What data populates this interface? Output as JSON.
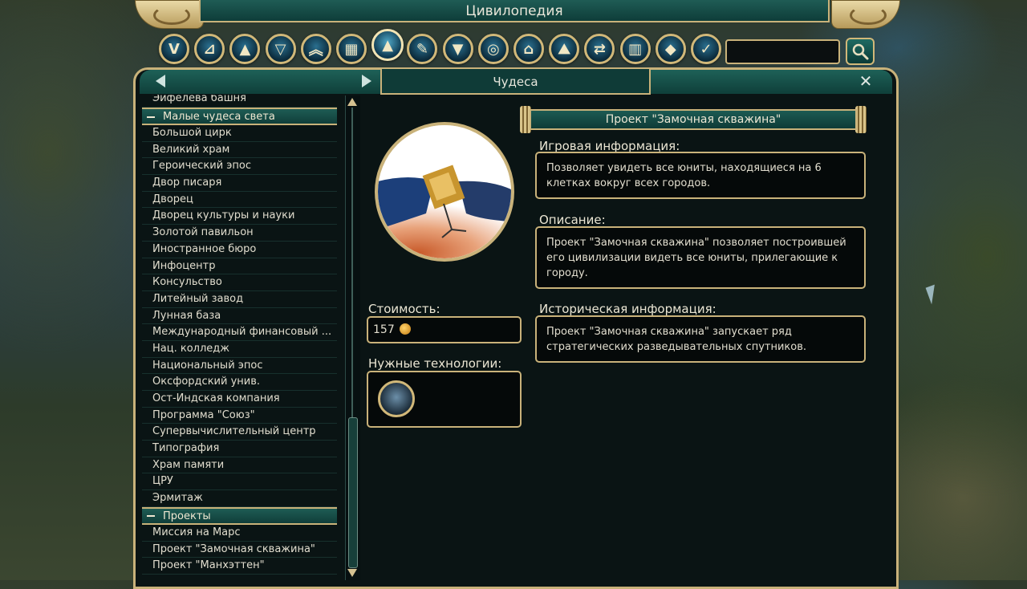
{
  "window": {
    "title": "Цивилопедия"
  },
  "categories": [
    {
      "icon": "v-icon",
      "glyph": "V"
    },
    {
      "icon": "compass-tools-icon",
      "glyph": "⊿"
    },
    {
      "icon": "tent-icon",
      "glyph": "▲"
    },
    {
      "icon": "triangle-emblem-icon",
      "glyph": "▽"
    },
    {
      "icon": "chevrons-icon",
      "glyph": "︽"
    },
    {
      "icon": "building-icon",
      "glyph": "▦"
    },
    {
      "icon": "pyramid-icon",
      "glyph": "▲",
      "active": true
    },
    {
      "icon": "scroll-icon",
      "glyph": "✎"
    },
    {
      "icon": "emblem-icon",
      "glyph": "▼"
    },
    {
      "icon": "globe-wreath-icon",
      "glyph": "◎"
    },
    {
      "icon": "capitol-icon",
      "glyph": "⌂"
    },
    {
      "icon": "ruins-icon",
      "glyph": "⛰"
    },
    {
      "icon": "handshake-icon",
      "glyph": "⇄"
    },
    {
      "icon": "city-icon",
      "glyph": "▥"
    },
    {
      "icon": "drop-icon",
      "glyph": "◆"
    },
    {
      "icon": "map-icon",
      "glyph": "✓"
    }
  ],
  "search": {
    "value": ""
  },
  "nav": {
    "section_title": "Чудеса",
    "close_glyph": "✕"
  },
  "list": {
    "top_item": "Эйфелева башня",
    "small_wonders_header": "Малые чудеса света",
    "small_wonders": [
      "Большой цирк",
      "Великий храм",
      "Героический эпос",
      "Двор писаря",
      "Дворец",
      "Дворец культуры и науки",
      "Золотой павильон",
      "Иностранное бюро",
      "Инфоцентр",
      "Консульство",
      "Литейный завод",
      "Лунная база",
      "Международный финансовый ...",
      "Нац. колледж",
      "Национальный эпос",
      "Оксфордский унив.",
      "Ост-Индская компания",
      "Программа \"Союз\"",
      "Супервычислительный центр",
      "Типография",
      "Храм памяти",
      "ЦРУ",
      "Эрмитаж"
    ],
    "projects_header": "Проекты",
    "projects": [
      "Миссия на Марс",
      "Проект \"Замочная скважина\"",
      "Проект \"Манхэттен\""
    ]
  },
  "detail": {
    "title": "Проект \"Замочная скважина\"",
    "cost_label": "Стоимость:",
    "cost_value": "157",
    "tech_label": "Нужные технологии:",
    "game_info_label": "Игровая информация:",
    "game_info_text": "Позволяет увидеть все юниты, находящиеся на 6 клетках вокруг всех городов.",
    "description_label": "Описание:",
    "description_text": "Проект \"Замочная скважина\" позволяет построившей его цивилизации видеть все юниты, прилегающие к городу.",
    "history_label": "Историческая информация:",
    "history_text": "Проект \"Замочная скважина\" запускает ряд стратегических разведывательных спутников."
  },
  "colors": {
    "gold": "#c9b27a",
    "teal": "#1e6158",
    "panel": "#0a1414"
  }
}
